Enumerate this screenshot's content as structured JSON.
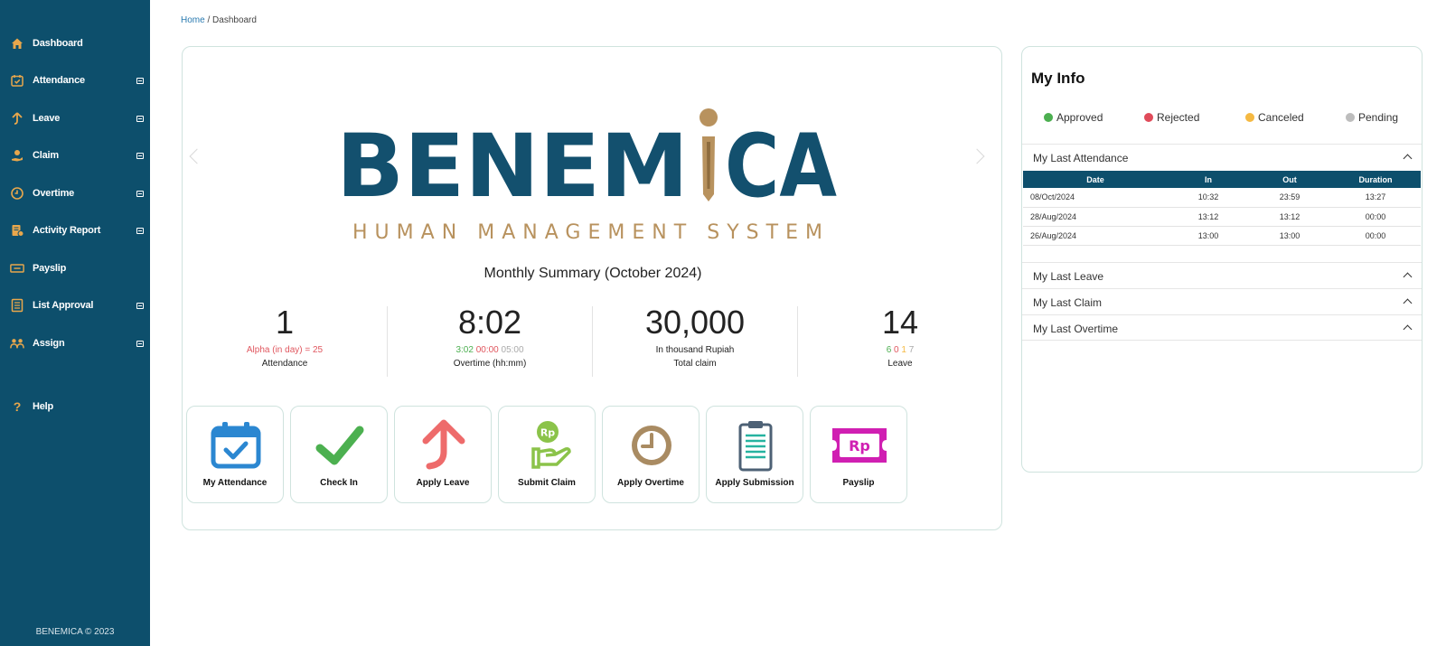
{
  "sidebar": {
    "items": [
      {
        "label": "Dashboard",
        "icon": "home-icon",
        "expandable": false
      },
      {
        "label": "Attendance",
        "icon": "calendar-check-icon",
        "expandable": true
      },
      {
        "label": "Leave",
        "icon": "arrow-up-icon",
        "expandable": true
      },
      {
        "label": "Claim",
        "icon": "money-hand-icon",
        "expandable": true
      },
      {
        "label": "Overtime",
        "icon": "clock-icon",
        "expandable": true
      },
      {
        "label": "Activity Report",
        "icon": "report-icon",
        "expandable": true
      },
      {
        "label": "Payslip",
        "icon": "payslip-icon",
        "expandable": false
      },
      {
        "label": "List Approval",
        "icon": "list-icon",
        "expandable": true
      },
      {
        "label": "Assign",
        "icon": "people-icon",
        "expandable": true
      },
      {
        "label": "Help",
        "icon": "question-icon",
        "expandable": false
      }
    ],
    "footer": "BENEMICA © 2023"
  },
  "breadcrumb": {
    "home": "Home",
    "separator": " / ",
    "current": "Dashboard"
  },
  "logo": {
    "name_left": "BENEM",
    "name_i": "I",
    "name_right": "CA",
    "tagline": "HUMAN MANAGEMENT SYSTEM"
  },
  "summary": {
    "title": "Monthly Summary (October 2024)",
    "stats": [
      {
        "value": "1",
        "sub": [
          {
            "text": "Alpha (in day) = 25",
            "color": "#e0575f"
          }
        ],
        "caption": "Attendance"
      },
      {
        "value": "8:02",
        "sub": [
          {
            "text": "3:02",
            "color": "#4caf50"
          },
          {
            "text": "00:00",
            "color": "#e0575f"
          },
          {
            "text": "05:00",
            "color": "#aaaaaa"
          }
        ],
        "caption": "Overtime (hh:mm)"
      },
      {
        "value": "30,000",
        "sub": [
          {
            "text": "In thousand Rupiah",
            "color": "#222222"
          }
        ],
        "caption": "Total claim"
      },
      {
        "value": "14",
        "sub": [
          {
            "text": "6",
            "color": "#4caf50"
          },
          {
            "text": "0",
            "color": "#e0575f"
          },
          {
            "text": "1",
            "color": "#f5b942"
          },
          {
            "text": "7",
            "color": "#aaaaaa"
          }
        ],
        "caption": "Leave"
      }
    ]
  },
  "actions": [
    {
      "label": "My Attendance",
      "icon": "calendar-check-icon"
    },
    {
      "label": "Check In",
      "icon": "check-icon"
    },
    {
      "label": "Apply Leave",
      "icon": "arrow-up-icon"
    },
    {
      "label": "Submit Claim",
      "icon": "money-hand-icon",
      "icon_text": "Rp"
    },
    {
      "label": "Apply Overtime",
      "icon": "clock-icon"
    },
    {
      "label": "Apply Submission",
      "icon": "clipboard-icon"
    },
    {
      "label": "Payslip",
      "icon": "ticket-icon",
      "icon_text": "Rp"
    }
  ],
  "my_info": {
    "title": "My Info",
    "legend": [
      {
        "label": "Approved",
        "color": "#4caf50"
      },
      {
        "label": "Rejected",
        "color": "#e04b5a"
      },
      {
        "label": "Canceled",
        "color": "#f5b942"
      },
      {
        "label": "Pending",
        "color": "#bdbdbd"
      }
    ],
    "sections": [
      {
        "title": "My Last Attendance"
      },
      {
        "title": "My Last Leave"
      },
      {
        "title": "My Last Claim"
      },
      {
        "title": "My Last Overtime"
      }
    ],
    "attendance_table": {
      "headers": [
        "Date",
        "In",
        "Out",
        "Duration"
      ],
      "rows": [
        [
          "08/Oct/2024",
          "10:32",
          "23:59",
          "13:27"
        ],
        [
          "28/Aug/2024",
          "13:12",
          "13:12",
          "00:00"
        ],
        [
          "26/Aug/2024",
          "13:00",
          "13:00",
          "00:00"
        ]
      ]
    }
  },
  "colors": {
    "sidebar": "#0d4f6c",
    "brand_blue": "#13506e",
    "brand_gold": "#b8925e"
  }
}
